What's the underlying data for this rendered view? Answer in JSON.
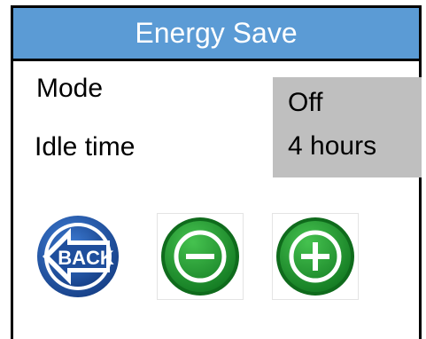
{
  "header": {
    "title": "Energy Save"
  },
  "settings": {
    "mode": {
      "label": "Mode",
      "value": "Off"
    },
    "idle_time": {
      "label": "Idle time",
      "value": "4 hours"
    }
  },
  "buttons": {
    "back": {
      "label": "BACK",
      "icon": "back-arrow-icon"
    },
    "decrease": {
      "icon": "minus-icon"
    },
    "increase": {
      "icon": "plus-icon"
    }
  },
  "colors": {
    "title_bar": "#5b9bd5",
    "value_panel": "#bfbfbf",
    "back_blue": "#1f4e9c",
    "green": "#1e9e2e"
  }
}
